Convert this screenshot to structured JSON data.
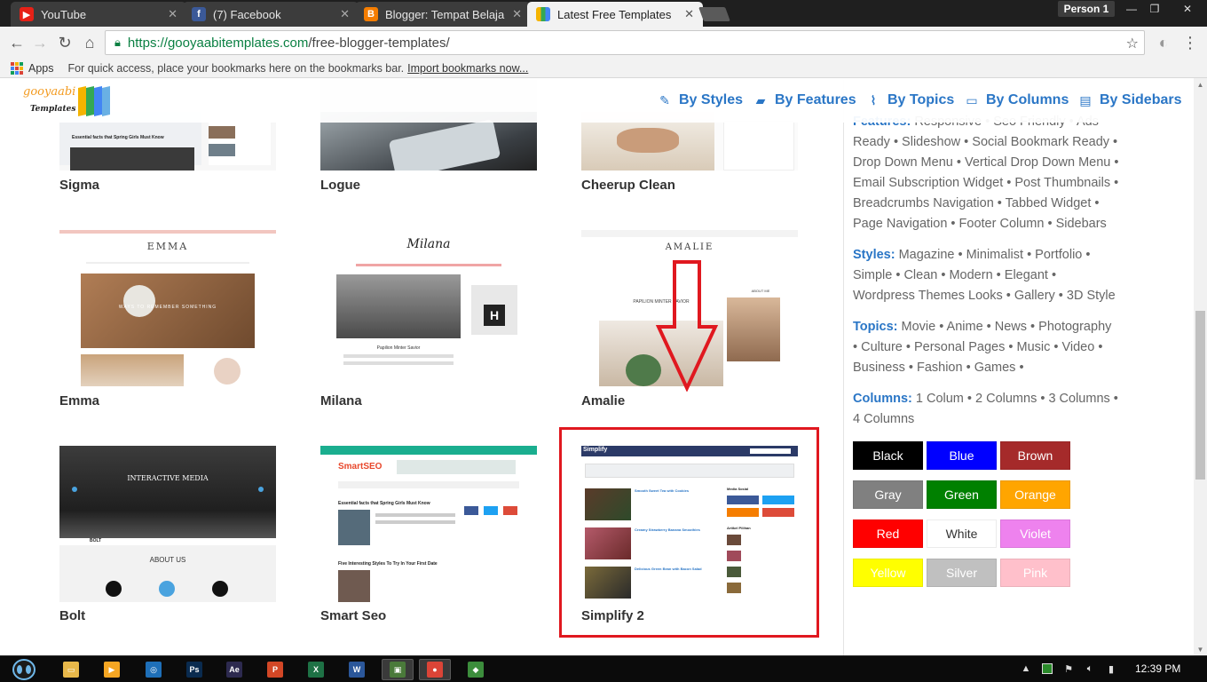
{
  "browser": {
    "tabs": [
      {
        "label": "YouTube",
        "icon": "youtube-icon",
        "color": "#e62117",
        "glyph": "▶"
      },
      {
        "label": "(7) Facebook",
        "icon": "facebook-icon",
        "color": "#3b5998",
        "glyph": "f"
      },
      {
        "label": "Blogger: Tempat Belaja",
        "icon": "blogger-icon",
        "color": "#f57d00",
        "glyph": "B"
      },
      {
        "label": "Latest Free Templates",
        "icon": "gooyaabi-icon",
        "color": "#34a853",
        "glyph": ""
      }
    ],
    "profile": "Person 1",
    "url_domain": "https://gooyaabitemplates.com",
    "url_path": "/free-blogger-templates/",
    "bookmarks_apps": "Apps",
    "bookmarks_message": "For quick access, place your bookmarks here on the bookmarks bar.",
    "bookmarks_link": "Import bookmarks now..."
  },
  "site": {
    "logo_top": "gooyaabi",
    "logo_bottom": "Templates",
    "menu": [
      {
        "label": "By Styles",
        "icon": "pencil-icon"
      },
      {
        "label": "By Features",
        "icon": "briefcase-icon"
      },
      {
        "label": "By Topics",
        "icon": "paperclip-icon"
      },
      {
        "label": "By Columns",
        "icon": "columns-icon"
      },
      {
        "label": "By Sidebars",
        "icon": "sidebar-icon"
      }
    ]
  },
  "gallery": [
    {
      "name": "Sigma"
    },
    {
      "name": "Logue"
    },
    {
      "name": "Cheerup Clean"
    },
    {
      "name": "Emma"
    },
    {
      "name": "Milana"
    },
    {
      "name": "Amalie"
    },
    {
      "name": "Bolt"
    },
    {
      "name": "Smart Seo"
    },
    {
      "name": "Simplify 2"
    }
  ],
  "thumb_text": {
    "sigma_caption": "Essential facts that Spring Girls Must Know",
    "emma_title": "EMMA",
    "emma_banner": "WAYS TO REMEMBER SOMETHING",
    "milana_title": "Milana",
    "milana_post": "Papilion Minter Savior",
    "amalie_title": "AMALIE",
    "amalie_post": "PAPILION MINTER SAVIOR",
    "amalie_about": "ABOUT ME",
    "bolt_banner": "INTERACTIVE MEDIA",
    "bolt_logo": "BOLT",
    "bolt_about": "ABOUT US",
    "smartseo_logo": "SmartSEO",
    "smartseo_post1": "Essential facts that Spring Girls Must Know",
    "smartseo_post2": "Five Interesting Styles To Try In Your First Date",
    "simplify_logo": "Simplify",
    "simplify_post1": "Smooth Sweet Tea with Cookies",
    "simplify_post2": "Creamy Strawberry Banana Smoothies",
    "simplify_post3": "Delicious Green Bean with Bacon Salad",
    "simplify_social": "Media Sosial",
    "simplify_popular": "Artikel Pilihan"
  },
  "sidebar": {
    "features_key": "Features:",
    "features": "Responsive • Seo Friendly • Ads Ready • Slideshow • Social Bookmark Ready • Drop Down Menu • Vertical Drop Down Menu • Email Subscription Widget • Post Thumbnails • Breadcrumbs Navigation • Tabbed Widget • Page Navigation • Footer Column • Sidebars",
    "styles_key": "Styles:",
    "styles": "Magazine • Minimalist • Portfolio • Simple • Clean • Modern • Elegant • Wordpress Themes Looks • Gallery • 3D Style",
    "topics_key": "Topics:",
    "topics": "Movie • Anime • News • Photography • Culture • Personal Pages • Music • Video • Business • Fashion • Games •",
    "columns_key": "Columns:",
    "columns": "1 Colum • 2 Columns • 3 Columns • 4 Columns",
    "colors": [
      {
        "label": "Black",
        "bg": "#000000",
        "fg": "#ffffff"
      },
      {
        "label": "Blue",
        "bg": "#0000ff",
        "fg": "#ffffff"
      },
      {
        "label": "Brown",
        "bg": "#a52a2a",
        "fg": "#ffffff"
      },
      {
        "label": "Gray",
        "bg": "#808080",
        "fg": "#ffffff"
      },
      {
        "label": "Green",
        "bg": "#008000",
        "fg": "#ffffff"
      },
      {
        "label": "Orange",
        "bg": "#ffa500",
        "fg": "#ffffff"
      },
      {
        "label": "Red",
        "bg": "#ff0000",
        "fg": "#ffffff"
      },
      {
        "label": "White",
        "bg": "#ffffff",
        "fg": "#333333"
      },
      {
        "label": "Violet",
        "bg": "#ee82ee",
        "fg": "#ffffff"
      },
      {
        "label": "Yellow",
        "bg": "#ffff00",
        "fg": "#ffffff"
      },
      {
        "label": "Silver",
        "bg": "#c0c0c0",
        "fg": "#ffffff"
      },
      {
        "label": "Pink",
        "bg": "#ffc0cb",
        "fg": "#ffffff"
      }
    ]
  },
  "taskbar": {
    "clock": "12:39 PM",
    "apps": [
      {
        "name": "file-explorer",
        "color": "#e8b84a",
        "glyph": "▭"
      },
      {
        "name": "media-player",
        "color": "#f5a623",
        "glyph": "▶"
      },
      {
        "name": "browser-globe",
        "color": "#1e6fb8",
        "glyph": "◎"
      },
      {
        "name": "photoshop",
        "color": "#0a2b4f",
        "glyph": "Ps"
      },
      {
        "name": "after-effects",
        "color": "#2d2a4f",
        "glyph": "Ae"
      },
      {
        "name": "presentation",
        "color": "#d24726",
        "glyph": "P"
      },
      {
        "name": "excel",
        "color": "#1e7145",
        "glyph": "X"
      },
      {
        "name": "word",
        "color": "#2b579a",
        "glyph": "W"
      },
      {
        "name": "screen-app",
        "color": "#4a7a3a",
        "glyph": "▣"
      },
      {
        "name": "chrome",
        "color": "#db4437",
        "glyph": "●"
      },
      {
        "name": "network-app",
        "color": "#3c8d3c",
        "glyph": "◆"
      }
    ]
  }
}
